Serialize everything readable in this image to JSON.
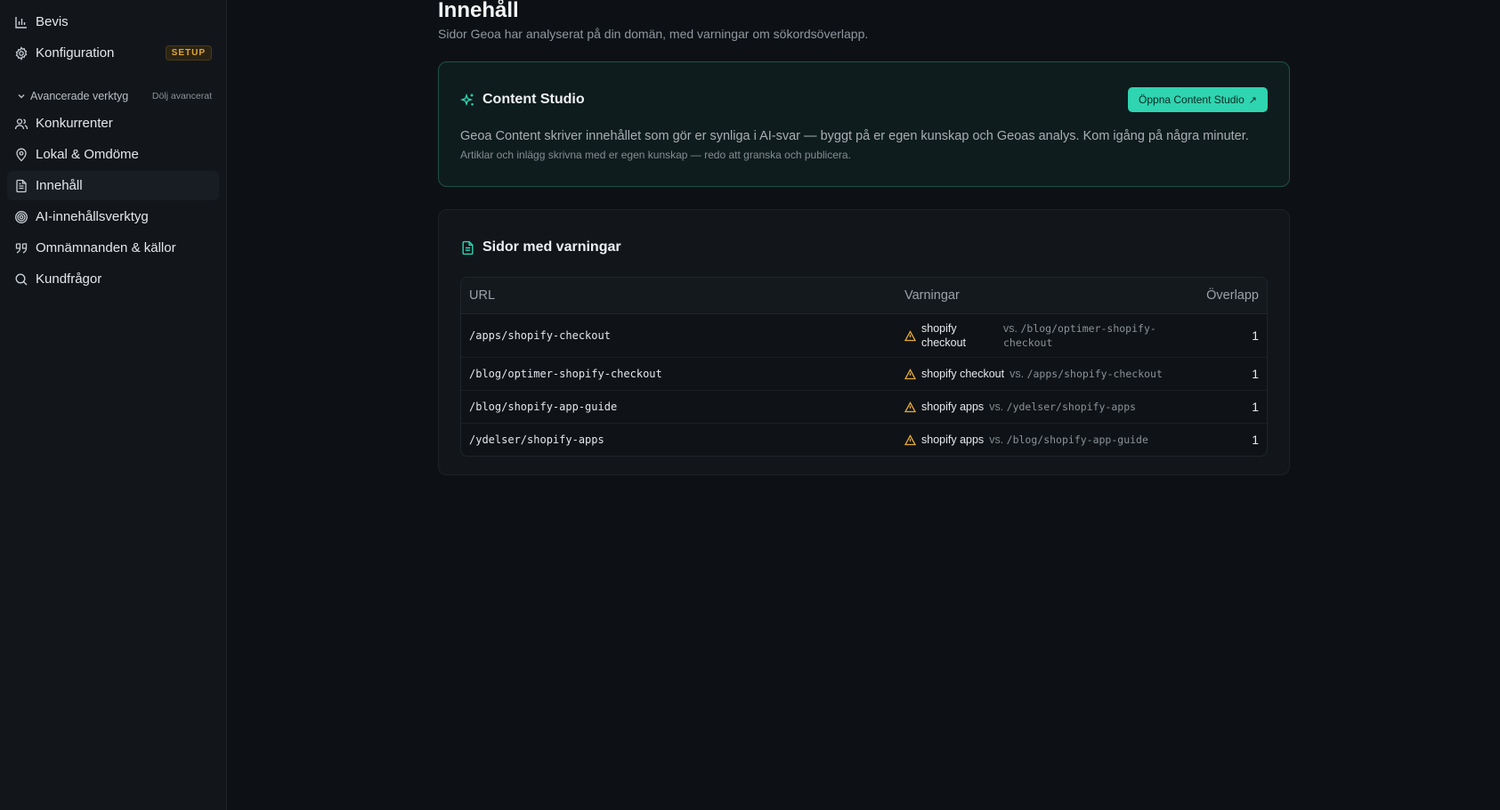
{
  "sidebar": {
    "top_items": [
      {
        "label": "Bevis",
        "icon": "bar-chart-icon"
      },
      {
        "label": "Konfiguration",
        "icon": "gear-icon",
        "badge": "SETUP"
      }
    ],
    "section": {
      "label": "Avancerade verktyg",
      "hide_label": "Dölj avancerat"
    },
    "items": [
      {
        "label": "Konkurrenter",
        "icon": "users-icon"
      },
      {
        "label": "Lokal & Omdöme",
        "icon": "map-pin-icon"
      },
      {
        "label": "Innehåll",
        "icon": "document-icon",
        "active": true
      },
      {
        "label": "AI-innehållsverktyg",
        "icon": "target-icon"
      },
      {
        "label": "Omnämnanden & källor",
        "icon": "quote-icon"
      },
      {
        "label": "Kundfrågor",
        "icon": "search-icon"
      }
    ]
  },
  "page": {
    "title": "Innehåll",
    "subtitle": "Sidor Geoa har analyserat på din domän, med varningar om sökordsöverlapp."
  },
  "studio": {
    "title": "Content Studio",
    "button": "Öppna Content Studio",
    "description": "Geoa Content skriver innehållet som gör er synliga i AI-svar — byggt på er egen kunskap och Geoas analys. Kom igång på några minuter.",
    "note": "Artiklar och inlägg skrivna med er egen kunskap — redo att granska och publicera."
  },
  "warnings": {
    "title": "Sidor med varningar",
    "columns": {
      "url": "URL",
      "warnings": "Varningar",
      "overlap": "Överlapp"
    },
    "rows": [
      {
        "url": "/apps/shopify-checkout",
        "keyword": "shopify checkout",
        "vs_prefix": "vs.",
        "vs_url": "/blog/optimer-shopify-checkout",
        "overlap": "1"
      },
      {
        "url": "/blog/optimer-shopify-checkout",
        "keyword": "shopify checkout",
        "vs_prefix": "vs.",
        "vs_url": "/apps/shopify-checkout",
        "overlap": "1"
      },
      {
        "url": "/blog/shopify-app-guide",
        "keyword": "shopify apps",
        "vs_prefix": "vs.",
        "vs_url": "/ydelser/shopify-apps",
        "overlap": "1"
      },
      {
        "url": "/ydelser/shopify-apps",
        "keyword": "shopify apps",
        "vs_prefix": "vs.",
        "vs_url": "/blog/shopify-app-guide",
        "overlap": "1"
      }
    ]
  },
  "colors": {
    "accent": "#2fd4b0",
    "warning": "#e4a93a",
    "badge": "#e0a53a",
    "background": "#0d1115"
  }
}
